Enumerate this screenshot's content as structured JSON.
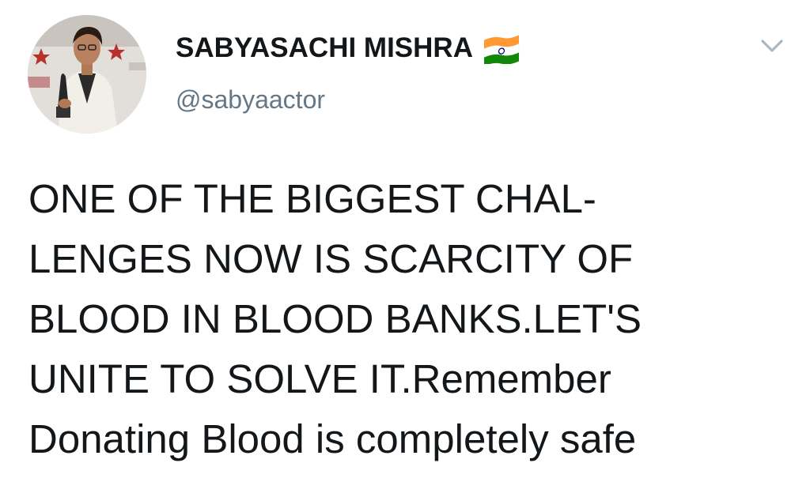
{
  "tweet": {
    "author": {
      "display_name": "SABYASACHI MISHRA",
      "handle": "@sabyaactor",
      "flag_icon": "india-flag-icon",
      "avatar": "profile-photo"
    },
    "menu_icon": "chevron-down-icon",
    "body_lines": [
      "ONE OF THE BIGGEST CHAL-",
      "LENGES NOW IS SCARCITY OF",
      "BLOOD IN BLOOD BANKS.LET'S",
      "UNITE TO SOLVE IT.Remember",
      "Donating Blood is completely safe"
    ]
  },
  "colors": {
    "text": "#14171a",
    "secondary_text": "#657786",
    "caret": "#aab8c2",
    "flag_saffron": "#ff9933",
    "flag_white": "#ffffff",
    "flag_green": "#138808",
    "flag_chakra": "#000080"
  }
}
